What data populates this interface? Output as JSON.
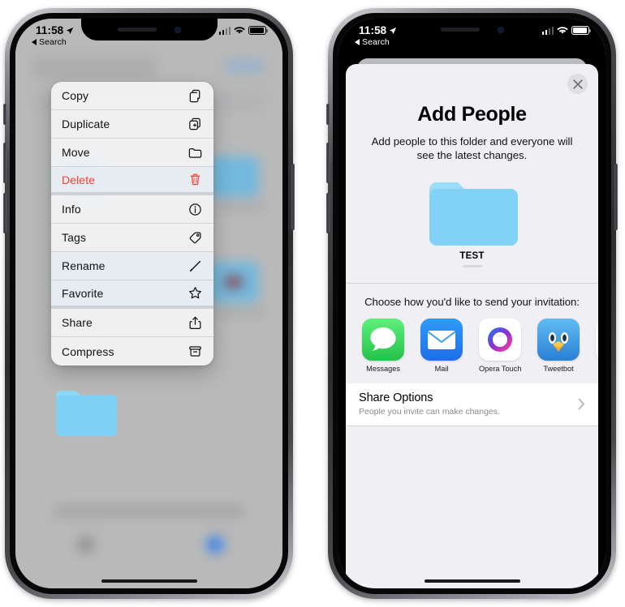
{
  "status_bar": {
    "time": "11:58",
    "back_label": "Search",
    "icons": {
      "location": "location-arrow-icon",
      "cellular": "cellular-bars-icon",
      "wifi": "wifi-icon",
      "battery": "battery-icon"
    }
  },
  "left_phone": {
    "context_menu": {
      "items": [
        {
          "label": "Copy",
          "icon": "copy-icon",
          "destructive": false
        },
        {
          "label": "Duplicate",
          "icon": "duplicate-icon",
          "destructive": false
        },
        {
          "label": "Move",
          "icon": "folder-icon",
          "destructive": false
        },
        {
          "label": "Delete",
          "icon": "trash-icon",
          "destructive": true
        },
        {
          "label": "Info",
          "icon": "info-icon",
          "destructive": false
        },
        {
          "label": "Tags",
          "icon": "tag-icon",
          "destructive": false
        },
        {
          "label": "Rename",
          "icon": "pencil-icon",
          "destructive": false
        },
        {
          "label": "Favorite",
          "icon": "star-icon",
          "destructive": false
        },
        {
          "label": "Share",
          "icon": "share-icon",
          "destructive": false
        },
        {
          "label": "Compress",
          "icon": "archive-icon",
          "destructive": false
        }
      ]
    },
    "selected_folder_icon": "folder-icon"
  },
  "right_phone": {
    "sheet": {
      "close_icon": "close-icon",
      "title": "Add People",
      "subtitle": "Add people to this folder and everyone will see the latest changes.",
      "folder_name": "TEST",
      "folder_icon": "folder-icon",
      "share_prompt": "Choose how you'd like to send your invitation:",
      "apps": [
        {
          "name": "Messages",
          "icon": "messages-app-icon"
        },
        {
          "name": "Mail",
          "icon": "mail-app-icon"
        },
        {
          "name": "Opera Touch",
          "icon": "opera-touch-app-icon"
        },
        {
          "name": "Tweetbot",
          "icon": "tweetbot-app-icon"
        },
        {
          "name": "",
          "icon": "flickr-app-icon"
        }
      ],
      "share_options": {
        "title": "Share Options",
        "subtitle": "People you invite can make changes.",
        "chevron_icon": "chevron-right-icon"
      }
    }
  },
  "colors": {
    "destructive": "#ff3b30",
    "folder_blue": "#8ad6f6",
    "messages_green": "#4cd964",
    "mail_blue": "#1d8cf0",
    "sheet_bg": "#f0f0f4"
  }
}
